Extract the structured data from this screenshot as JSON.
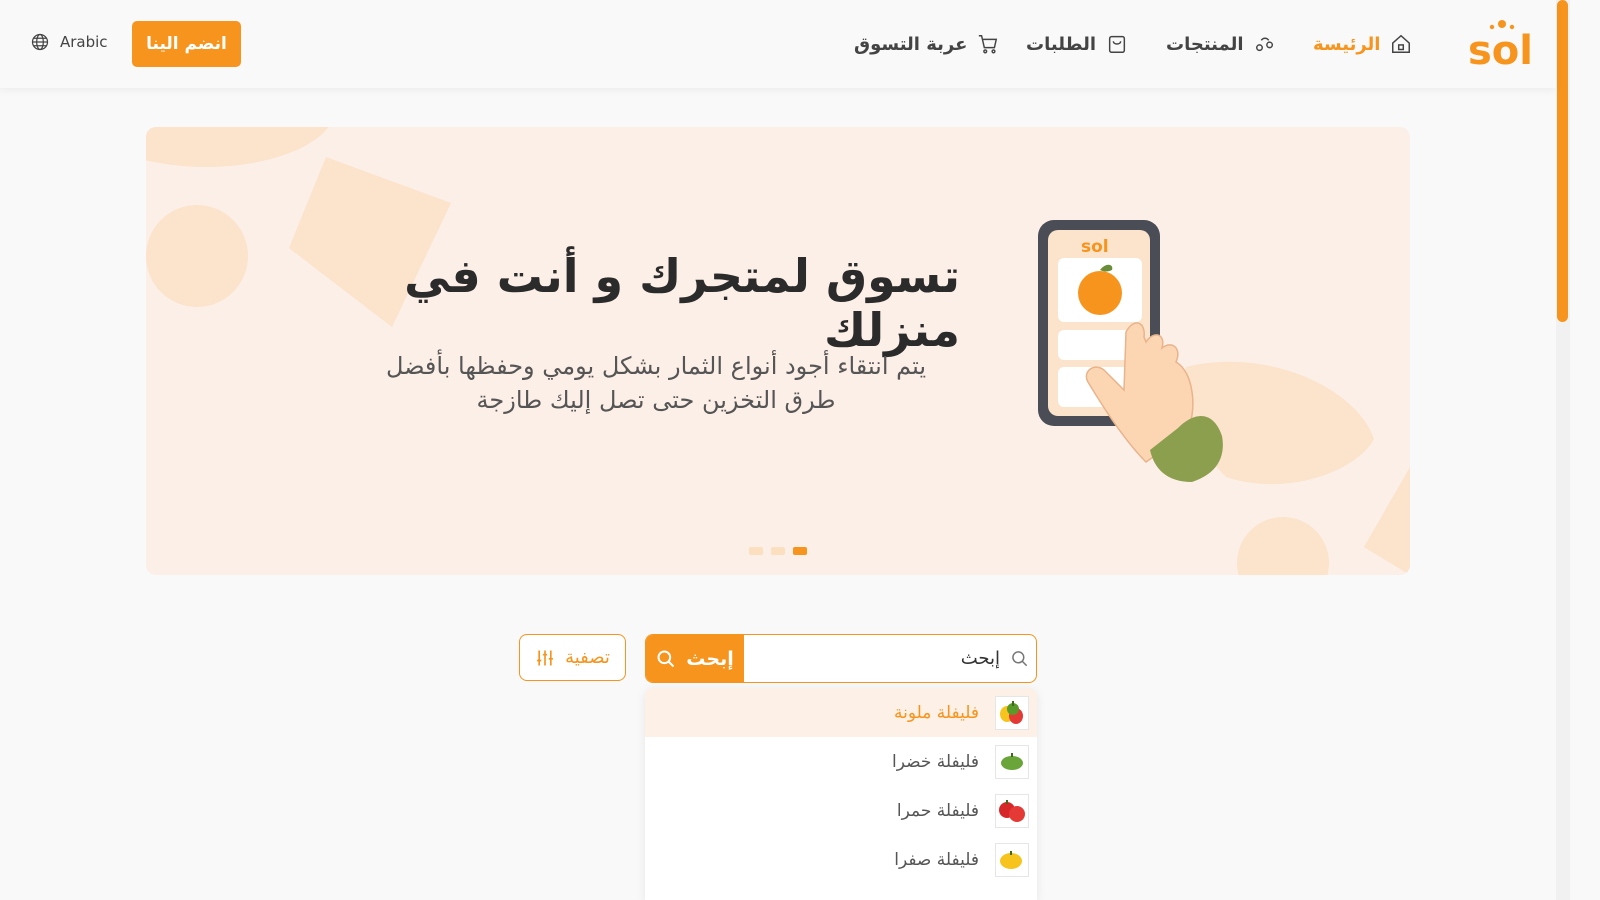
{
  "header": {
    "logo_text": "sol",
    "nav": [
      {
        "label": "الرئيسة",
        "icon": "home-icon",
        "active": true
      },
      {
        "label": "المنتجات",
        "icon": "products-icon",
        "active": false
      },
      {
        "label": "الطلبات",
        "icon": "orders-bag-icon",
        "active": false
      },
      {
        "label": "عربة التسوق",
        "icon": "cart-icon",
        "active": false
      }
    ],
    "join_label": "انضم الينا",
    "language_label": "Arabic"
  },
  "banner": {
    "title": "تسوق لمتجرك و أنت في منزلك",
    "subtitle_line1": "يتم انتقاء أجود أنواع الثمار بشكل يومي وحفظها بأفضل",
    "subtitle_line2": "طرق التخزين حتى تصل إليك طازجة",
    "phone_logo": "sol",
    "slides_total": 3,
    "active_slide": 3
  },
  "search": {
    "value": "إبحث",
    "button_label": "إبحث",
    "filter_label": "تصفية"
  },
  "suggestions": [
    {
      "label": "فليفلة ملونة",
      "icon": "mixed-peppers-icon",
      "highlighted": true
    },
    {
      "label": "فليفلة خضرا",
      "icon": "green-pepper-icon",
      "highlighted": false
    },
    {
      "label": "فليفلة حمرا",
      "icon": "red-pepper-icon",
      "highlighted": false
    },
    {
      "label": "فليفلة صفرا",
      "icon": "yellow-pepper-icon",
      "highlighted": false
    }
  ],
  "colors": {
    "accent": "#f7941d",
    "banner_bg": "#fcefe7",
    "page_bg": "#f9f9f9"
  }
}
